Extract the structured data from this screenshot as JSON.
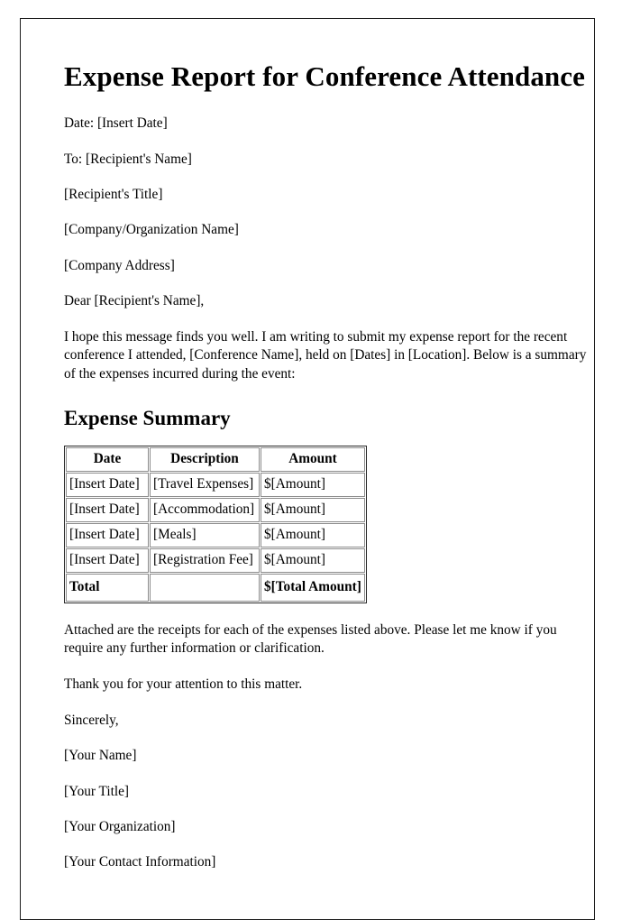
{
  "document": {
    "title": "Expense Report for Conference Attendance",
    "header_lines": [
      "Date: [Insert Date]",
      "To: [Recipient's Name]",
      "[Recipient's Title]",
      "[Company/Organization Name]",
      "[Company Address]"
    ],
    "salutation": "Dear [Recipient's Name],",
    "intro_paragraph": "I hope this message finds you well. I am writing to submit my expense report for the recent conference I attended, [Conference Name], held on [Dates] in [Location]. Below is a summary of the expenses incurred during the event:",
    "section_heading": "Expense Summary",
    "table": {
      "columns": [
        "Date",
        "Description",
        "Amount"
      ],
      "rows": [
        [
          "[Insert Date]",
          "[Travel Expenses]",
          "$[Amount]"
        ],
        [
          "[Insert Date]",
          "[Accommodation]",
          "$[Amount]"
        ],
        [
          "[Insert Date]",
          "[Meals]",
          "$[Amount]"
        ],
        [
          "[Insert Date]",
          "[Registration Fee]",
          "$[Amount]"
        ]
      ],
      "total_row": [
        "Total",
        "",
        "$[Total Amount]"
      ]
    },
    "closing_paragraphs": [
      "Attached are the receipts for each of the expenses listed above. Please let me know if you require any further information or clarification.",
      "Thank you for your attention to this matter."
    ],
    "sign_off": "Sincerely,",
    "signature_lines": [
      "[Your Name]",
      "[Your Title]",
      "[Your Organization]",
      "[Your Contact Information]"
    ]
  },
  "colors": {
    "text": "#000000",
    "page_border": "#1c1c1c",
    "table_outer_border": "#2a2a2a",
    "table_cell_border": "#8c8c8c",
    "background": "#ffffff"
  }
}
